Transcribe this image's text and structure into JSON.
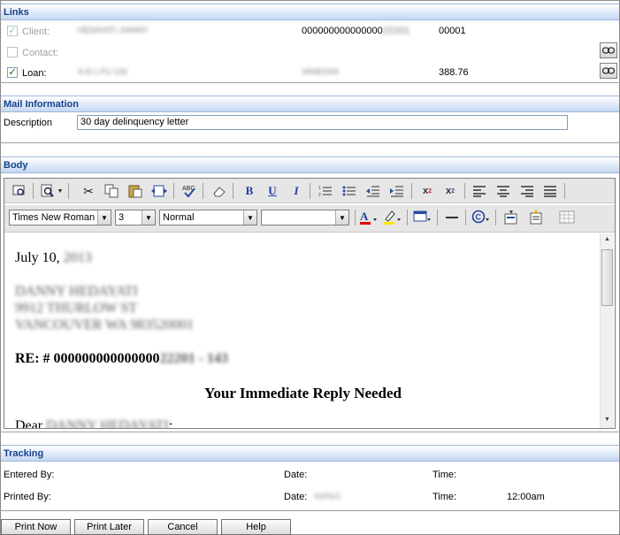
{
  "links": {
    "header": "Links",
    "client": {
      "label": "Client:",
      "name": "HEDAYATI, DANNY",
      "account": "000000000000000",
      "account_tail": "22201",
      "code": "00001"
    },
    "contact": {
      "label": "Contact:"
    },
    "loan": {
      "label": "Loan:",
      "product": "A-D L-FU 143",
      "officer": "VANESSA",
      "amount": "388.76"
    }
  },
  "mail": {
    "header": "Mail Information",
    "description_label": "Description",
    "description_value": "30 day delinquency letter"
  },
  "body": {
    "header": "Body",
    "toolbar": {
      "font": "Times New Roman",
      "size": "3",
      "style": "Normal",
      "blank": ""
    },
    "document": {
      "date_prefix": "July 10,",
      "date_year": "2013",
      "addr1": "DANNY HEDAYATI",
      "addr2": "9912 THURLOW ST",
      "addr3": "VANCOUVER WA 983520001",
      "re_label": "RE: # 000000000000000",
      "re_tail": "22201 - 143",
      "headline": "Your Immediate Reply Needed",
      "dear_prefix": "Dear",
      "dear_name": "DANNY HEDAYATI"
    }
  },
  "tracking": {
    "header": "Tracking",
    "entered_by_label": "Entered By:",
    "printed_by_label": "Printed By:",
    "date_label": "Date:",
    "time_label": "Time:",
    "printed_date": "01/01/1",
    "printed_time": "12:00am"
  },
  "buttons": {
    "print_now": "Print Now",
    "print_later": "Print Later",
    "cancel": "Cancel",
    "help": "Help"
  }
}
